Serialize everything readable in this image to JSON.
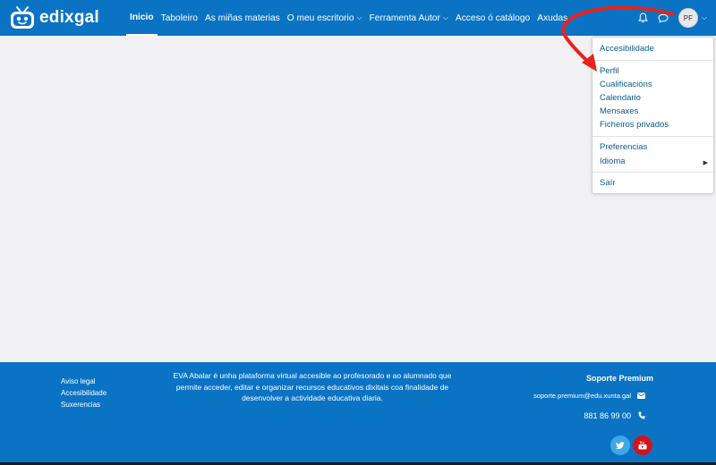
{
  "brand": {
    "name": "edixgal",
    "logo_icon": "tv-face-logo-icon"
  },
  "nav": {
    "items": [
      {
        "label": "Inicio",
        "active": true,
        "has_dropdown": false
      },
      {
        "label": "Taboleiro",
        "active": false,
        "has_dropdown": false
      },
      {
        "label": "As miñas materias",
        "active": false,
        "has_dropdown": false
      },
      {
        "label": "O meu escritorio",
        "active": false,
        "has_dropdown": true
      },
      {
        "label": "Ferramenta Autor",
        "active": false,
        "has_dropdown": true
      },
      {
        "label": "Acceso ó catálogo",
        "active": false,
        "has_dropdown": false
      },
      {
        "label": "Axudas",
        "active": false,
        "has_dropdown": true
      }
    ],
    "icons": [
      "bell-icon",
      "chat-bubble-icon"
    ],
    "avatar_initials": "PF"
  },
  "user_menu": {
    "items": [
      {
        "label": "Accesibilidade"
      },
      {
        "label": "Perfil"
      },
      {
        "label": "Cualificacións"
      },
      {
        "label": "Calendario"
      },
      {
        "label": "Mensaxes"
      },
      {
        "label": "Ficheiros privados"
      },
      {
        "label": "Preferencias"
      },
      {
        "label": "Idioma",
        "has_submenu": true
      },
      {
        "label": "Saír"
      }
    ]
  },
  "footer": {
    "links": [
      {
        "label": "Aviso legal"
      },
      {
        "label": "Accesibilidade"
      },
      {
        "label": "Suxerencias"
      }
    ],
    "description": "EVA Abalar é unha plataforma virtual accesible ao profesorado e ao alumnado que permite acceder, editar e organizar recursos educativos dixitais coa finalidade de desenvolver a actividade educativa diaria.",
    "support": {
      "title": "Soporte Premium",
      "email": "soporte.premium@edu.xunta.gal",
      "phone": "881 86 99 00"
    },
    "social": [
      "twitter-icon",
      "youtube-icon"
    ]
  },
  "colors": {
    "primary": "#0b73c4",
    "background": "#f1f1f4",
    "link": "#0b5a8f",
    "annotation_arrow": "#e8231a",
    "twitter": "#3ea7e8",
    "youtube": "#d0141d"
  }
}
